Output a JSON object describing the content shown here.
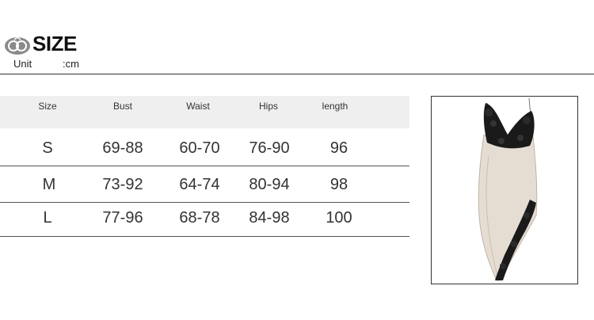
{
  "header": {
    "title": "SIZE",
    "unit_label": "Unit",
    "unit_value": ":cm",
    "logo_icon": "rings-icon"
  },
  "table": {
    "columns": [
      "Size",
      "Bust",
      "Waist",
      "Hips",
      "length"
    ],
    "rows": [
      [
        "S",
        "69-88",
        "60-70",
        "76-90",
        "96"
      ],
      [
        "M",
        "73-92",
        "64-74",
        "80-94",
        "98"
      ],
      [
        "L",
        "77-96",
        "68-78",
        "84-98",
        "100"
      ]
    ]
  },
  "product_image": {
    "subject": "dress-icon",
    "colors": {
      "body": "#e6ddd2",
      "lace": "#1a1a1a"
    }
  }
}
